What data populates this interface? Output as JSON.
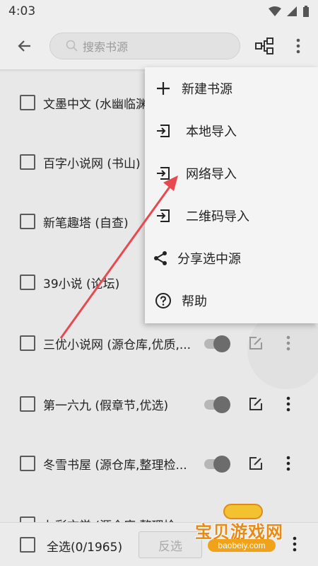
{
  "status_bar": {
    "time": "4:03"
  },
  "app_bar": {
    "search_placeholder": "搜索书源"
  },
  "list": {
    "rows": [
      {
        "label": "文墨中文 (水幽临渊"
      },
      {
        "label": "百字小说网 (书山)"
      },
      {
        "label": "新笔趣塔 (自查)"
      },
      {
        "label": "39小说 (论坛)"
      },
      {
        "label": "三优小说网 (源仓库,优质,..."
      },
      {
        "label": "第一六九 (假章节,优选)"
      },
      {
        "label": "冬雪书屋 (源仓库,整理检..."
      },
      {
        "label": "七彩文学 (源仓库,整理检"
      }
    ]
  },
  "popup_menu": {
    "items": [
      {
        "label": "新建书源",
        "icon": "plus-icon"
      },
      {
        "label": "本地导入",
        "icon": "import-icon"
      },
      {
        "label": "网络导入",
        "icon": "import-icon"
      },
      {
        "label": "二维码导入",
        "icon": "import-icon"
      },
      {
        "label": "分享选中源",
        "icon": "share-icon"
      },
      {
        "label": "帮助",
        "icon": "help-icon"
      }
    ]
  },
  "bottom_bar": {
    "select_all_label": "全选(0/1965)",
    "invert_label": "反选"
  },
  "watermark": {
    "title": "宝贝游戏网",
    "url": "baobeiy.com"
  },
  "colors": {
    "arrow": "#e8494f",
    "accent": "#e88a14"
  }
}
